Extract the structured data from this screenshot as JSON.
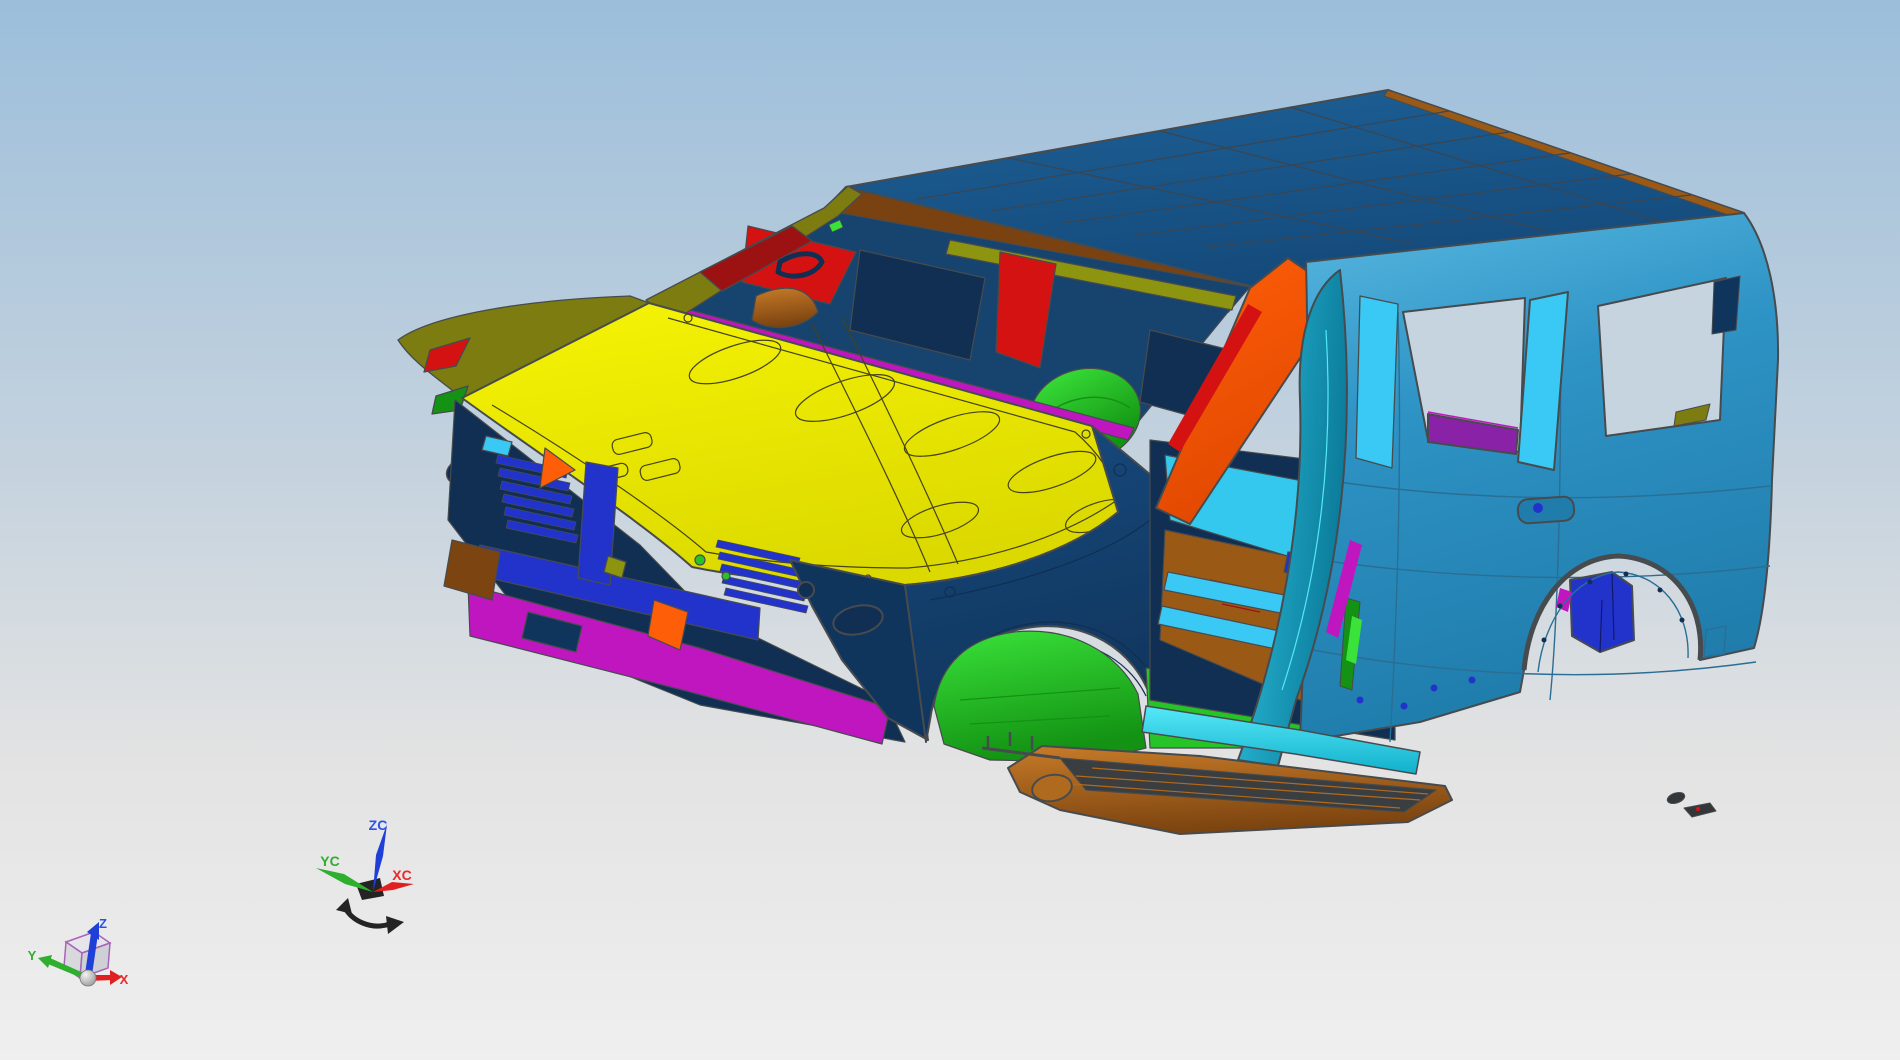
{
  "scene": {
    "description": "Automotive body-in-white CAD assembly, front three-quarter isometric view",
    "viewport_kind": "3D CAD modeling viewport"
  },
  "wcs_triad": {
    "z_label": "ZC",
    "y_label": "YC",
    "x_label": "XC"
  },
  "view_triad": {
    "z_label": "Z",
    "y_label": "Y",
    "x_label": "X"
  },
  "background": {
    "sky_top": "#9cbedb",
    "sky_mid": "#c6d3de",
    "ground": "#e3e3e3",
    "ground_bottom": "#efefef"
  },
  "palette": {
    "edge": "#474b4e",
    "roof_top": "#1d6096",
    "roof_bottom": "#14497a",
    "roof_line": "#3b4550",
    "header_brown": "#7a4210",
    "trim_brown": "#9a5a16",
    "hood_top": "#f6f404",
    "hood_bottom": "#dcd900",
    "hood_line": "#45431a",
    "olive": "#7c7c10",
    "olive_bright": "#8c9410",
    "interior_blue": "#16446f",
    "interior_dark": "#102f52",
    "maroon": "#9c1212",
    "red": "#d51212",
    "green_light": "#3ae23a",
    "green_mid": "#27c427",
    "green_dark": "#139213",
    "magenta": "#c016c0",
    "purple": "#7d1895",
    "violet": "#8a22a8",
    "orange": "#ff5e08",
    "orange_dark": "#e04800",
    "royal": "#2233cc",
    "royal_dark": "#111a66",
    "navy": "#174a7e",
    "navy_dark": "#10355c",
    "steel_light": "#58b8e0",
    "steel": "#2e93c5",
    "steel_dark": "#1f7cab",
    "steel_line": "#2a6e94",
    "cyan": "#3ac8f4",
    "cyan_floor": "#35c8ee",
    "sill_top": "#55e8f8",
    "sill_bottom": "#12b0cc",
    "teal_top": "#2cc0dc",
    "teal_bottom": "#0c7c9c",
    "copper_light": "#c77b28",
    "copper": "#b06a1e",
    "copper_dark": "#7c4410",
    "rocker_top": "#3b3e41",
    "dark_part": "#33373a",
    "window_bg": "#c6d4e0",
    "axis_x": "#e82a2a",
    "axis_y": "#2fae2f",
    "axis_z": "#2a52e8",
    "arrow_x": "#e02020",
    "arrow_y": "#2faf2f",
    "arrow_z": "#1f3fd9",
    "handle_black": "#242424",
    "cube_edge": "#a864b8",
    "cube_face_top": "#e6e6ea",
    "cube_face_left": "#d6d6dc",
    "cube_face_right": "#cccdd4",
    "sphere_light": "#f2f2f2",
    "sphere_dark": "#8e8e8e"
  }
}
